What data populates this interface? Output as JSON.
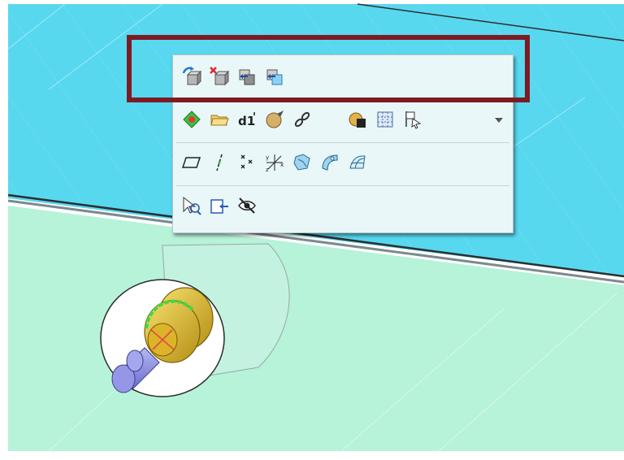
{
  "viewport": {
    "background_colors": {
      "upper_part": "#57d8ef",
      "lower_part": "#b6f3d8",
      "white_margin": "#ffffff",
      "edge_line": "#3c3c3c"
    }
  },
  "model": {
    "parts": [
      "cylinder",
      "gear",
      "shaft"
    ],
    "colors": {
      "cylinder_face": "#ffffff",
      "gear": "#e6c23a",
      "gear_highlight": "#43d843",
      "shaft": "#8e91e6",
      "axis_marker": "#e04a4a"
    }
  },
  "mini_toolbar": {
    "rows": [
      {
        "group": "placement-commands",
        "highlighted": true,
        "icons": [
          "move-part-icon",
          "delete-part-icon",
          "assembly-back-icon",
          "assembly-forward-icon"
        ]
      },
      {
        "group": "part-commands",
        "icons": [
          "add-point-icon",
          "open-folder-icon",
          "dimension-icon",
          "appearance-sphere-icon",
          "link-icon",
          "material-icon",
          "grid-icon",
          "select-flag-icon"
        ],
        "dropdown": "chevron-down-icon"
      },
      {
        "group": "constraint-commands",
        "icons": [
          "plane-icon",
          "axis-icon",
          "scatter-points-icon",
          "coordinate-system-icon",
          "surface-patch-icon",
          "curve-surface-icon",
          "mesh-surface-icon"
        ]
      },
      {
        "group": "view-commands",
        "icons": [
          "zoom-select-icon",
          "insert-box-icon",
          "hide-icon"
        ]
      }
    ],
    "highlight_color": "#7e1a22"
  }
}
